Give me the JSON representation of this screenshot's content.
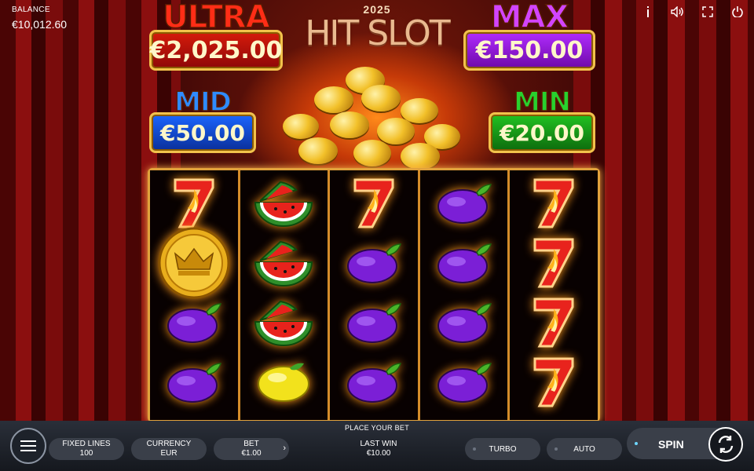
{
  "balance": {
    "label": "BALANCE",
    "value": "€10,012.60"
  },
  "top_icons": [
    "info-icon",
    "sound-icon",
    "fullscreen-icon",
    "power-icon"
  ],
  "logo": {
    "year": "2025",
    "name": "HIT SLOT"
  },
  "jackpots": {
    "ultra": {
      "title": "ULTRA",
      "amount": "€2,025.00",
      "color": "#ff2d16"
    },
    "max": {
      "title": "MAX",
      "amount": "€150.00",
      "color": "#d244ff"
    },
    "mid": {
      "title": "MID",
      "amount": "€50.00",
      "color": "#2f8bff"
    },
    "min": {
      "title": "MIN",
      "amount": "€20.00",
      "color": "#28d12e"
    }
  },
  "reels": [
    [
      "seven",
      "coin",
      "plum",
      "plum"
    ],
    [
      "watermelon",
      "watermelon",
      "watermelon",
      "lemon"
    ],
    [
      "seven",
      "plum",
      "plum",
      "plum"
    ],
    [
      "plum",
      "plum",
      "plum",
      "plum"
    ],
    [
      "seven",
      "seven",
      "seven",
      "seven"
    ]
  ],
  "bottom": {
    "place_bet": "PLACE YOUR BET",
    "fixed_lines": {
      "label": "FIXED LINES",
      "value": "100"
    },
    "currency": {
      "label": "CURRENCY",
      "value": "EUR"
    },
    "bet": {
      "label": "BET",
      "value": "€1.00"
    },
    "last_win": {
      "label": "LAST WIN",
      "value": "€10.00"
    },
    "turbo": "TURBO",
    "auto": "AUTO",
    "spin": "SPIN"
  }
}
